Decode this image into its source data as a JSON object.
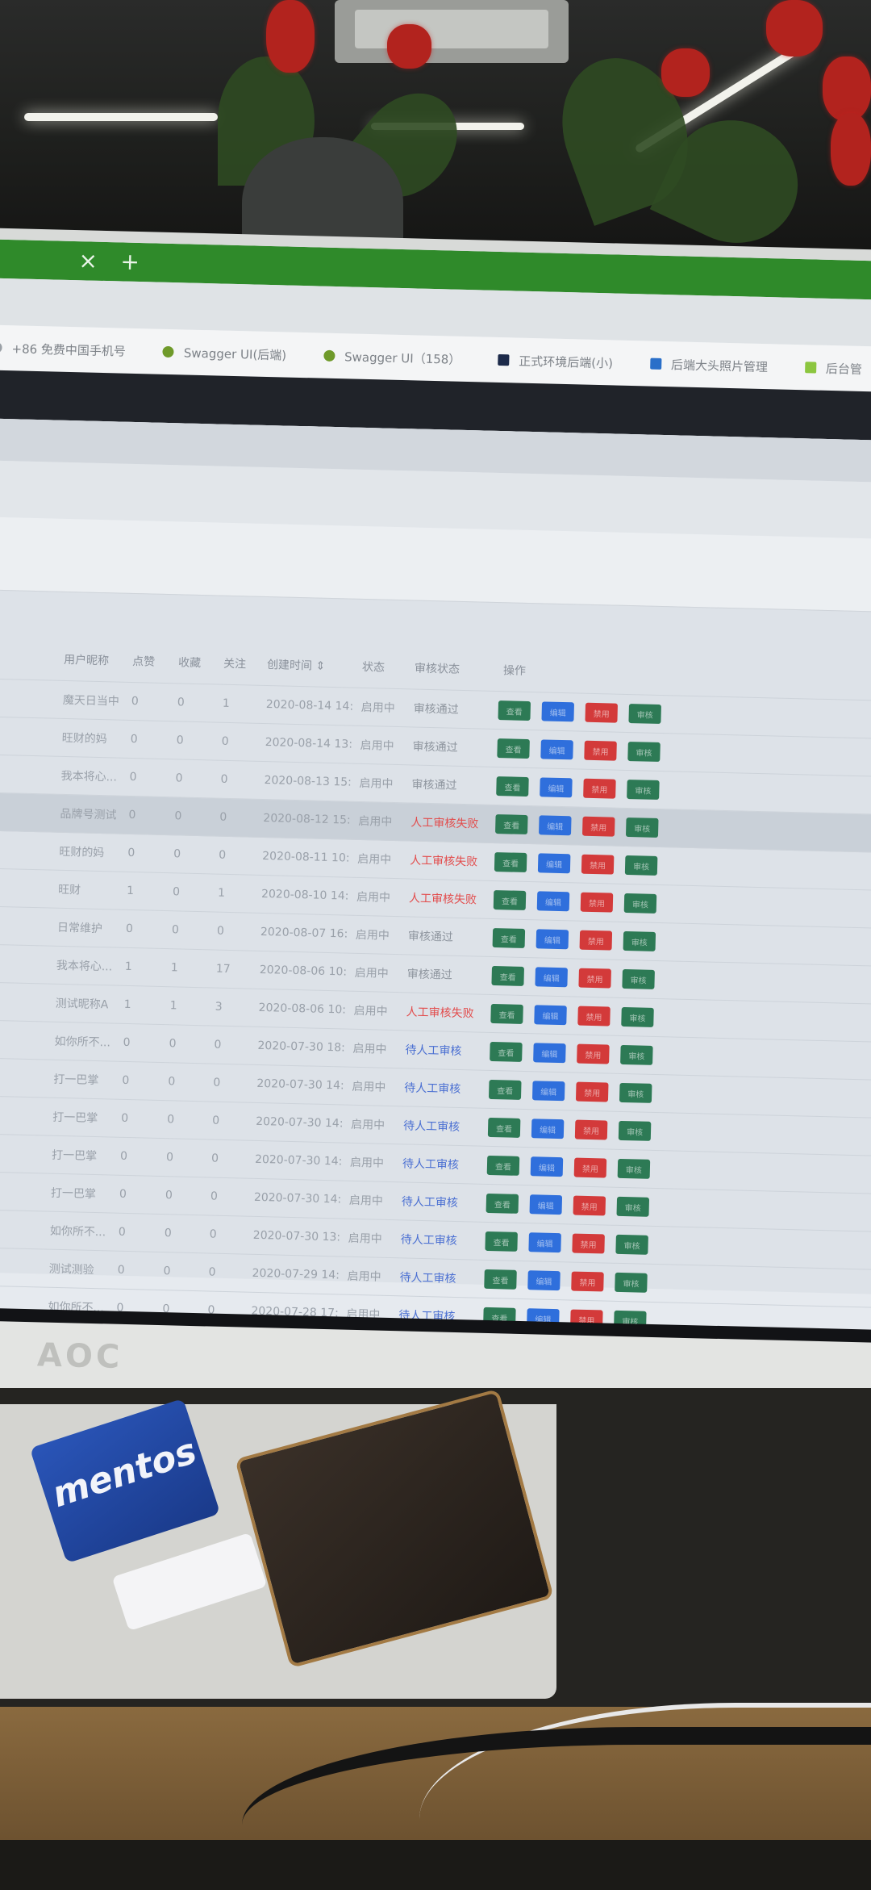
{
  "browser": {
    "tab_close_glyph": "×",
    "tab_add_glyph": "+",
    "bookmarks": [
      {
        "label": "+86 免费中国手机号",
        "icon": "globe-icon",
        "color": "#9aa0a6"
      },
      {
        "label": "Swagger UI(后端)",
        "icon": "swagger-icon",
        "color": "#6f9a2a"
      },
      {
        "label": "Swagger UI（158）",
        "icon": "swagger-icon",
        "color": "#6f9a2a"
      },
      {
        "label": "正式环境后端(小)",
        "icon": "doc-icon",
        "color": "#1c2a4a"
      },
      {
        "label": "后端大头照片管理",
        "icon": "app-icon",
        "color": "#2a6fc9"
      },
      {
        "label": "后台管",
        "icon": "bookmark-icon",
        "color": "#8cc63f"
      }
    ]
  },
  "table": {
    "headers": [
      "用户昵称",
      "点赞",
      "收藏",
      "关注",
      "创建时间 ⇕",
      "状态",
      "审核状态",
      "操作"
    ],
    "rows": [
      {
        "name": "魔天日当中",
        "likes": "0",
        "favs": "0",
        "follows": "1",
        "created": "2020-08-14 14:",
        "status": "启用中",
        "review": "审核通过",
        "review_type": "pass"
      },
      {
        "name": "旺财的妈",
        "likes": "0",
        "favs": "0",
        "follows": "0",
        "created": "2020-08-14 13:",
        "status": "启用中",
        "review": "审核通过",
        "review_type": "pass"
      },
      {
        "name": "我本将心...",
        "likes": "0",
        "favs": "0",
        "follows": "0",
        "created": "2020-08-13 15:",
        "status": "启用中",
        "review": "审核通过",
        "review_type": "pass"
      },
      {
        "name": "品牌号测试",
        "likes": "0",
        "favs": "0",
        "follows": "0",
        "created": "2020-08-12 15:",
        "status": "启用中",
        "review": "人工审核失败",
        "review_type": "fail"
      },
      {
        "name": "旺财的妈",
        "likes": "0",
        "favs": "0",
        "follows": "0",
        "created": "2020-08-11 10:",
        "status": "启用中",
        "review": "人工审核失败",
        "review_type": "fail"
      },
      {
        "name": "旺财",
        "likes": "1",
        "favs": "0",
        "follows": "1",
        "created": "2020-08-10 14:",
        "status": "启用中",
        "review": "人工审核失败",
        "review_type": "fail"
      },
      {
        "name": "日常维护",
        "likes": "0",
        "favs": "0",
        "follows": "0",
        "created": "2020-08-07 16:",
        "status": "启用中",
        "review": "审核通过",
        "review_type": "pass"
      },
      {
        "name": "我本将心...",
        "likes": "1",
        "favs": "1",
        "follows": "17",
        "created": "2020-08-06 10:",
        "status": "启用中",
        "review": "审核通过",
        "review_type": "pass"
      },
      {
        "name": "测试昵称A",
        "likes": "1",
        "favs": "1",
        "follows": "3",
        "created": "2020-08-06 10:",
        "status": "启用中",
        "review": "人工审核失败",
        "review_type": "fail"
      },
      {
        "name": "如你所不...",
        "likes": "0",
        "favs": "0",
        "follows": "0",
        "created": "2020-07-30 18:",
        "status": "启用中",
        "review": "待人工审核",
        "review_type": "wait"
      },
      {
        "name": "打一巴掌",
        "likes": "0",
        "favs": "0",
        "follows": "0",
        "created": "2020-07-30 14:",
        "status": "启用中",
        "review": "待人工审核",
        "review_type": "wait"
      },
      {
        "name": "打一巴掌",
        "likes": "0",
        "favs": "0",
        "follows": "0",
        "created": "2020-07-30 14:",
        "status": "启用中",
        "review": "待人工审核",
        "review_type": "wait"
      },
      {
        "name": "打一巴掌",
        "likes": "0",
        "favs": "0",
        "follows": "0",
        "created": "2020-07-30 14:",
        "status": "启用中",
        "review": "待人工审核",
        "review_type": "wait"
      },
      {
        "name": "打一巴掌",
        "likes": "0",
        "favs": "0",
        "follows": "0",
        "created": "2020-07-30 14:",
        "status": "启用中",
        "review": "待人工审核",
        "review_type": "wait"
      },
      {
        "name": "如你所不...",
        "likes": "0",
        "favs": "0",
        "follows": "0",
        "created": "2020-07-30 13:",
        "status": "启用中",
        "review": "待人工审核",
        "review_type": "wait"
      },
      {
        "name": "测试测验",
        "likes": "0",
        "favs": "0",
        "follows": "0",
        "created": "2020-07-29 14:",
        "status": "启用中",
        "review": "待人工审核",
        "review_type": "wait"
      },
      {
        "name": "如你所不...",
        "likes": "0",
        "favs": "0",
        "follows": "0",
        "created": "2020-07-28 17:",
        "status": "启用中",
        "review": "待人工审核",
        "review_type": "wait"
      }
    ],
    "highlighted_row": 3,
    "action_buttons": [
      {
        "label": "查看",
        "color": "#2d7a55"
      },
      {
        "label": "编辑",
        "color": "#2f6fdc"
      },
      {
        "label": "禁用",
        "color": "#d33a3a"
      },
      {
        "label": "审核",
        "color": "#2d7a55"
      }
    ]
  },
  "monitor": {
    "brand": "AOC"
  },
  "desk_items": {
    "mentos_label": "mentos"
  }
}
